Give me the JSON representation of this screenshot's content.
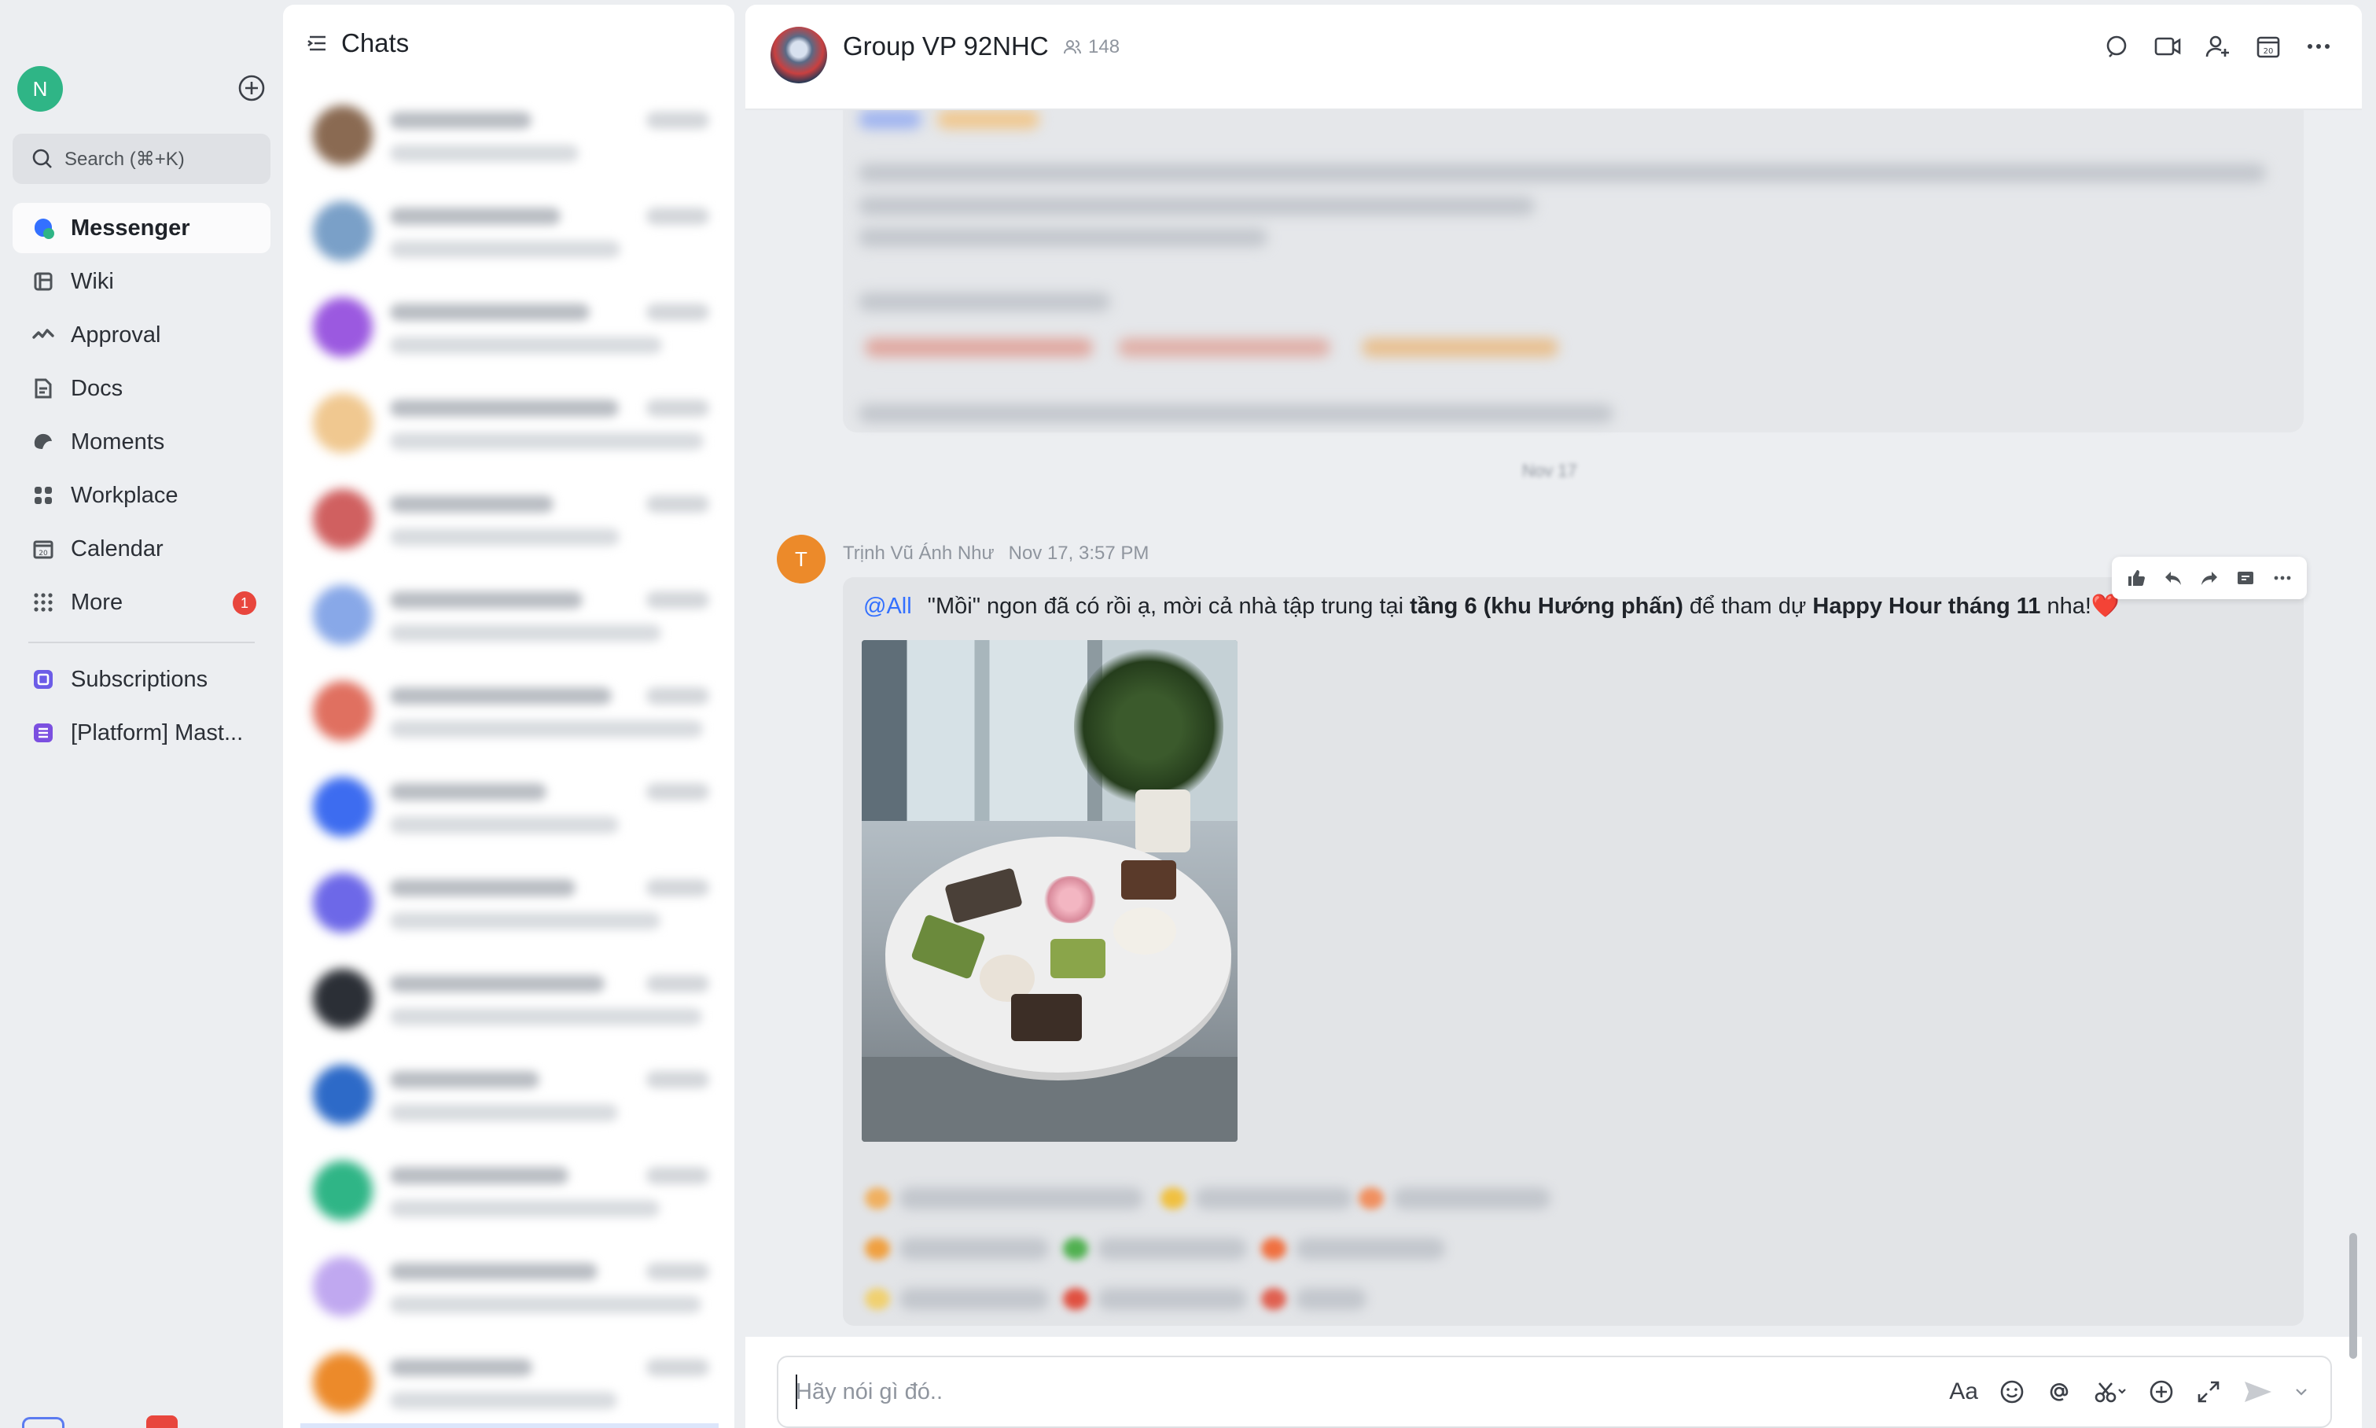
{
  "nav": {
    "avatar_initial": "N",
    "search_placeholder": "Search (⌘+K)",
    "items": [
      {
        "label": "Messenger",
        "icon": "messenger-icon",
        "active": true
      },
      {
        "label": "Wiki",
        "icon": "wiki-icon"
      },
      {
        "label": "Approval",
        "icon": "approval-icon"
      },
      {
        "label": "Docs",
        "icon": "docs-icon"
      },
      {
        "label": "Moments",
        "icon": "moments-icon"
      },
      {
        "label": "Workplace",
        "icon": "workplace-icon"
      },
      {
        "label": "Calendar",
        "icon": "calendar-icon"
      },
      {
        "label": "More",
        "icon": "more-icon",
        "badge": "1"
      }
    ],
    "shortcuts": [
      {
        "label": "Subscriptions",
        "icon": "subscriptions-icon"
      },
      {
        "label": "[Platform] Mast...",
        "icon": "sheet-icon"
      }
    ],
    "calendar_icon_text": "20"
  },
  "chatlist": {
    "title": "Chats",
    "rows": [
      {
        "color": "#8a6a52"
      },
      {
        "color": "#7aa0c8"
      },
      {
        "color": "#9b59e0"
      },
      {
        "color": "#f0c890"
      },
      {
        "color": "#d06060"
      },
      {
        "color": "#88a8e8"
      },
      {
        "color": "#e07060"
      },
      {
        "color": "#3d6cf0"
      },
      {
        "color": "#6d68e8"
      },
      {
        "color": "#2b2f36"
      },
      {
        "color": "#2d6ac8"
      },
      {
        "color": "#2fb586"
      },
      {
        "color": "#c0a8f0"
      },
      {
        "color": "#ec8a2a"
      }
    ]
  },
  "conversation": {
    "group_name": "Group VP 92NHC",
    "member_count": "148",
    "date_separator": "Nov 17",
    "message": {
      "sender_initial": "T",
      "sender_name": "Trịnh Vũ Ánh Như",
      "time": "Nov 17, 3:57 PM",
      "mention": "@All",
      "text_1": "\"Mồi\" ngon đã có rồi ạ, mời cả nhà tập trung tại ",
      "bold_1": "tầng 6 (khu Hướng phấn)",
      "text_2": " để tham dự ",
      "bold_2": "Happy Hour tháng 11",
      "text_3": " nha!",
      "emoji": "❤️"
    },
    "input_placeholder": "Hãy nói gì đó..",
    "input_format_label": "Aa"
  },
  "colors": {
    "accent": "#3370ff",
    "badge": "#e8463d",
    "sender_avatar": "#ec8a2a",
    "user_avatar": "#2fb586"
  }
}
